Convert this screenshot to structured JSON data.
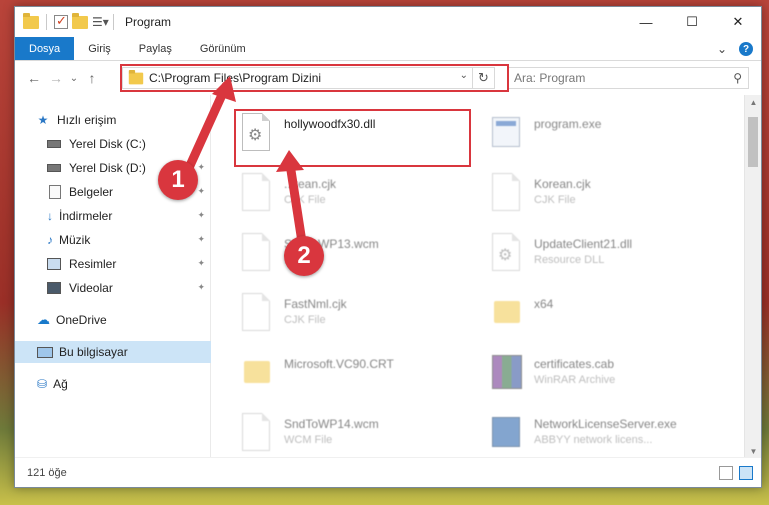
{
  "titlebar": {
    "title": "Program",
    "minimize": "—",
    "maximize": "☐",
    "close": "✕"
  },
  "ribbon": {
    "tabs": [
      {
        "label": "Dosya",
        "active": true
      },
      {
        "label": "Giriş"
      },
      {
        "label": "Paylaş"
      },
      {
        "label": "Görünüm"
      }
    ],
    "expand_glyph": "⌄",
    "help_glyph": "?"
  },
  "nav": {
    "back": "←",
    "forward": "→",
    "recent": "⌄",
    "up": "↑"
  },
  "address": {
    "path": "C:\\Program Files\\Program Dizini",
    "dropdown": "⌄",
    "refresh": "↻"
  },
  "search": {
    "placeholder": "Ara: Program",
    "icon": "⚲"
  },
  "sidebar": {
    "items": [
      {
        "label": "Hızlı erişim",
        "icon": "star-icon"
      },
      {
        "label": "Yerel Disk (C:)",
        "icon": "drive-icon",
        "pinned": true
      },
      {
        "label": "Yerel Disk (D:)",
        "icon": "drive-icon",
        "pinned": true
      },
      {
        "label": "Belgeler",
        "icon": "document-icon",
        "pinned": true
      },
      {
        "label": "İndirmeler",
        "icon": "download-icon",
        "pinned": true
      },
      {
        "label": "Müzik",
        "icon": "music-icon",
        "pinned": true
      },
      {
        "label": "Resimler",
        "icon": "pictures-icon",
        "pinned": true
      },
      {
        "label": "Videolar",
        "icon": "videos-icon",
        "pinned": true
      },
      {
        "label": "OneDrive",
        "icon": "cloud-icon"
      },
      {
        "label": "Bu bilgisayar",
        "icon": "computer-icon",
        "selected": true
      },
      {
        "label": "Ağ",
        "icon": "network-icon"
      }
    ],
    "pin_glyph": "📌"
  },
  "files": [
    {
      "name": "hollywoodfx30.dll",
      "type": "",
      "icon": "dll-icon",
      "highlighted": true
    },
    {
      "name": "program.exe",
      "type": "",
      "icon": "exe-icon"
    },
    {
      "name": "...rean.cjk",
      "type": "CJK File",
      "icon": "blank-file-icon"
    },
    {
      "name": "Korean.cjk",
      "type": "CJK File",
      "icon": "blank-file-icon"
    },
    {
      "name": "SndToWP13.wcm",
      "type": "...e",
      "icon": "blank-file-icon"
    },
    {
      "name": "UpdateClient21.dll",
      "type": "Resource DLL",
      "icon": "dll-icon"
    },
    {
      "name": "FastNml.cjk",
      "type": "CJK File",
      "icon": "blank-file-icon"
    },
    {
      "name": "x64",
      "type": "",
      "icon": "folder-icon"
    },
    {
      "name": "Microsoft.VC90.CRT",
      "type": "",
      "icon": "folder-icon"
    },
    {
      "name": "certificates.cab",
      "type": "WinRAR Archive",
      "icon": "archive-icon"
    },
    {
      "name": "SndToWP14.wcm",
      "type": "WCM File",
      "icon": "blank-file-icon"
    },
    {
      "name": "NetworkLicenseServer.exe",
      "type": "ABBYY network licens...",
      "icon": "network-exe-icon"
    }
  ],
  "statusbar": {
    "count": "121 öğe"
  },
  "callouts": {
    "one": "1",
    "two": "2"
  },
  "colors": {
    "accent": "#1979ca",
    "highlight_red": "#d9363e",
    "selected_bg": "#cce4f7"
  }
}
